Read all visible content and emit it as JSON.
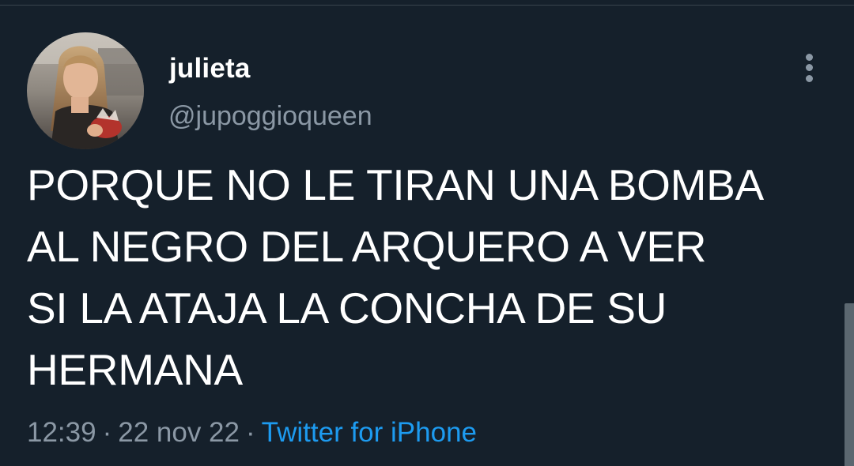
{
  "tweet": {
    "display_name": "julieta",
    "handle": "@jupoggioqueen",
    "text": "PORQUE NO LE TIRAN UNA BOMBA\nAL NEGRO DEL ARQUERO A VER\nSI LA ATAJA LA CONCHA DE SU\nHERMANA",
    "time": "12:39",
    "separator": "·",
    "date": "22 nov 22",
    "source": "Twitter for iPhone"
  },
  "icons": {
    "more": "more-vertical-icon"
  },
  "colors": {
    "background": "#15202b",
    "text_primary": "#ffffff",
    "text_secondary": "#8b98a5",
    "link": "#1d9bf0",
    "divider": "#38444d"
  }
}
